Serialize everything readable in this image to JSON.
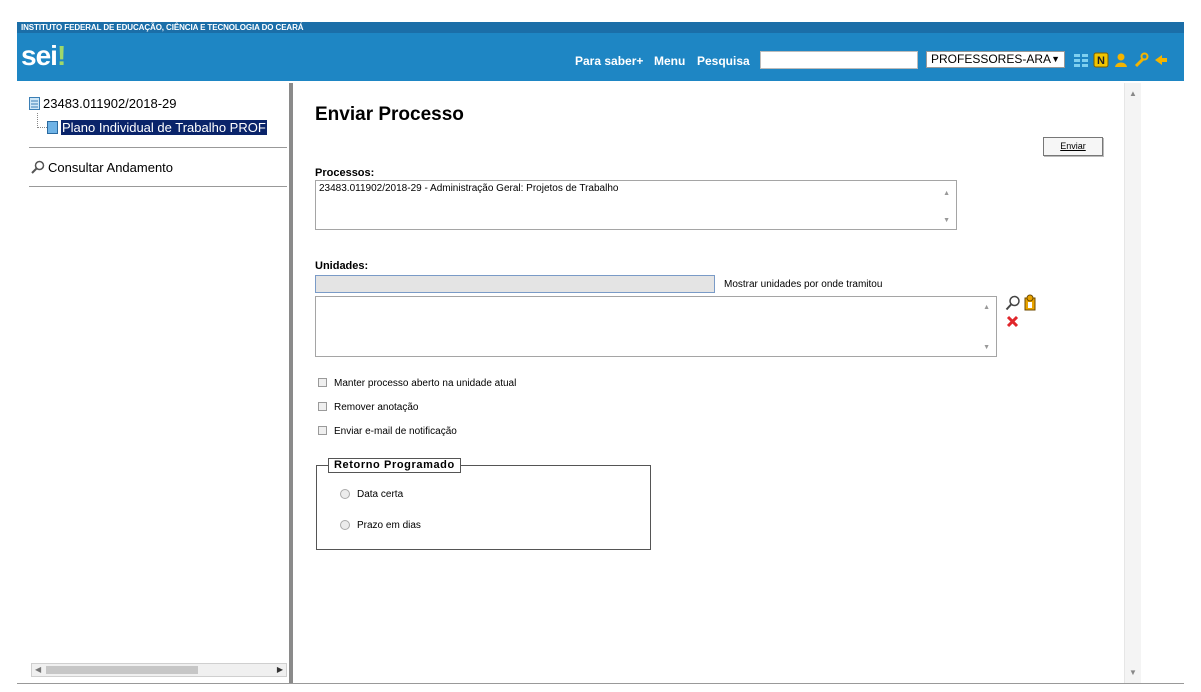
{
  "header": {
    "institution": "INSTITUTO FEDERAL DE EDUCAÇÃO, CIÊNCIA E TECNOLOGIA DO CEARÁ",
    "logo_main": "sei",
    "logo_mark": "!",
    "links": {
      "para_saber": "Para saber+",
      "menu": "Menu",
      "pesquisa": "Pesquisa"
    },
    "search_value": "",
    "unit_selected": "PROFESSORES-ARA",
    "icons": [
      "list-icon",
      "n-badge-icon",
      "user-icon",
      "wrench-icon",
      "exit-icon"
    ]
  },
  "tree": {
    "process_number": "23483.011902/2018-29",
    "document_label": "Plano Individual de Trabalho PROF",
    "consult_label": "Consultar Andamento"
  },
  "form": {
    "title": "Enviar Processo",
    "submit_label": "Enviar",
    "processos_label": "Processos:",
    "processos_value": "23483.011902/2018-29 - Administração Geral: Projetos de Trabalho",
    "unidades_label": "Unidades:",
    "unidades_value": "",
    "show_units_label": "Mostrar unidades por onde tramitou",
    "checkboxes": [
      {
        "label": "Manter processo aberto na unidade atual",
        "checked": false
      },
      {
        "label": "Remover anotação",
        "checked": false
      },
      {
        "label": "Enviar e-mail de notificação",
        "checked": false
      }
    ],
    "retorno": {
      "legend": "Retorno Programado",
      "options": [
        {
          "label": "Data certa",
          "selected": false
        },
        {
          "label": "Prazo em dias",
          "selected": false
        }
      ]
    }
  },
  "colors": {
    "header_blue": "#1e86c4",
    "strip_blue": "#1b6ea8",
    "selection": "#0a246a",
    "logo_accent": "#9fd86a",
    "remove_red": "#e0262b"
  }
}
